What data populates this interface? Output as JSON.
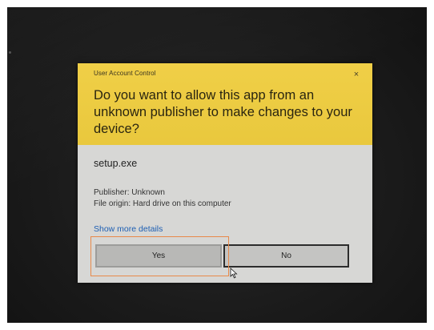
{
  "dialog": {
    "window_title": "User Account Control",
    "close_glyph": "×",
    "question": "Do you want to allow this app from an unknown publisher to make changes to your device?",
    "app_name": "setup.exe",
    "publisher": "Publisher: Unknown",
    "file_origin": "File origin: Hard drive on this computer",
    "details_link": "Show more details",
    "yes_label": "Yes",
    "no_label": "No"
  },
  "colors": {
    "header": "#e9c83d",
    "body": "#d7d7d5",
    "link": "#1e5fb3",
    "highlight_box": "#e8894a"
  },
  "icons": [
    "close-icon",
    "mouse-cursor-icon"
  ]
}
